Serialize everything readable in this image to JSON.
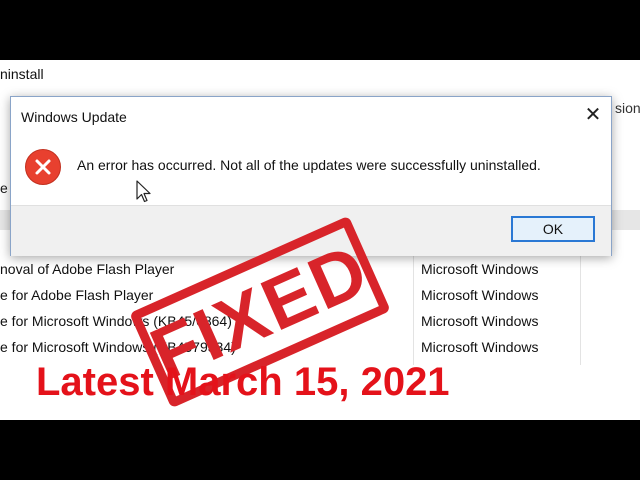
{
  "background_window": {
    "header_fragment": "ninstall",
    "right_column_fragment": "sion",
    "left_edge_letters": [
      "e",
      "e",
      "e",
      "e"
    ],
    "rows": [
      {
        "name": "noval of Adobe Flash Player",
        "publisher": "Microsoft Windows"
      },
      {
        "name": "e for Adobe Flash Player",
        "publisher": "Microsoft Windows"
      },
      {
        "name": "e for Microsoft Windows (KB45/6864)",
        "publisher": "Microsoft Windows"
      },
      {
        "name": "e for Microsoft Windows (KB4579334)",
        "publisher": "Microsoft Windows"
      }
    ]
  },
  "dialog": {
    "title": "Windows Update",
    "close_glyph": "✕",
    "message": "An error has occurred. Not all of the updates were successfully uninstalled.",
    "ok_label": "OK",
    "icon": "error-icon"
  },
  "overlay": {
    "stamp_text": "FIXED",
    "caption": "Latest March 15, 2021"
  },
  "colors": {
    "stamp": "#d8242a",
    "caption": "#e4121a",
    "error_icon": "#e8402f",
    "ok_border": "#2a78d4"
  }
}
